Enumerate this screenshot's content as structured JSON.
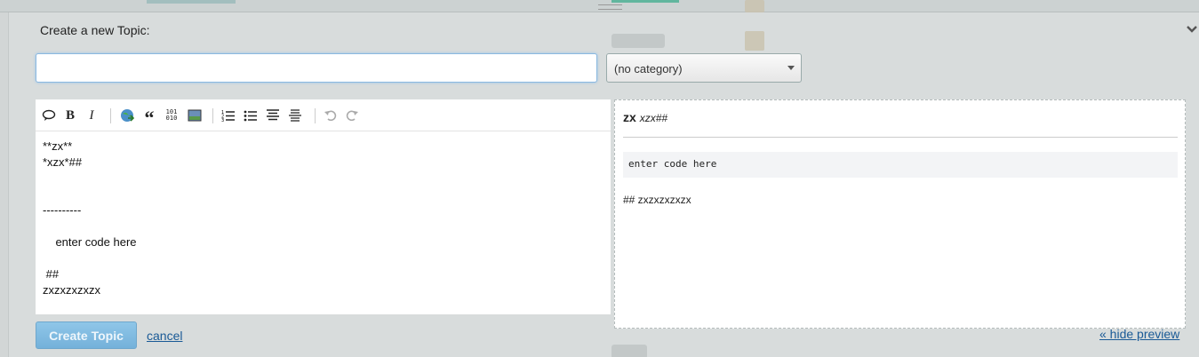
{
  "composer": {
    "heading": "Create a new Topic:",
    "title_value": "",
    "category_selected": "(no category)",
    "toolbar_icons": [
      "quote-bubble-icon",
      "bold-icon",
      "italic-icon",
      "link-icon",
      "blockquote-icon",
      "code-icon",
      "image-icon",
      "ordered-list-icon",
      "bullet-list-icon",
      "heading-icon",
      "horizontal-rule-icon",
      "undo-icon",
      "redo-icon"
    ],
    "toolbar_labels": {
      "bold": "B",
      "italic": "I",
      "blockquote": "“",
      "code_top": "101",
      "code_bottom": "010"
    },
    "editor_lines": [
      "**zx**",
      "*xzx*##",
      "",
      "",
      "----------",
      "",
      "    enter code here",
      "",
      " ##",
      "zxzxzxzxzx"
    ],
    "preview": {
      "bold_text": "zx",
      "italic_text": "xzx##",
      "code_text": "enter code here",
      "last_line": "## zxzxzxzxzx"
    },
    "create_button": "Create Topic",
    "cancel_link": "cancel",
    "hide_preview_link": "« hide preview"
  },
  "colors": {
    "accent": "#74b1da",
    "link": "#1a5a96",
    "overlay": "#d8dcdc"
  }
}
